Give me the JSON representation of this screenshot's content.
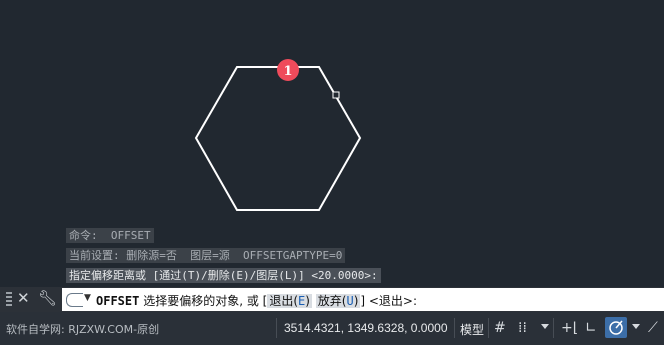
{
  "command_history": [
    "命令:  OFFSET",
    "当前设置: 删除源=否  图层=源  OFFSETGAPTYPE=0",
    "指定偏移距离或 [通过(T)/删除(E)/图层(L)] <20.0000>:"
  ],
  "command_line": {
    "command": "OFFSET",
    "prompt": "选择要偏移的对象, 或 [",
    "opt1_label": "退出(",
    "opt1_key": "E",
    "opt1_close": ")",
    "opt2_label": "放弃(",
    "opt2_key": "U",
    "opt2_close": ")",
    "suffix": "] <退出>:"
  },
  "marker_number": "1",
  "status_bar": {
    "watermark": "软件自学网: RJZXW.COM-原创",
    "coordinates": "3514.4321, 1349.6328, 0.0000",
    "model_label": "模型"
  },
  "colors": {
    "canvas_bg": "#212830",
    "hexagon_stroke": "#ffffff",
    "marker_fill": "#ef4b5b",
    "active_toggle": "#3c6ea8"
  },
  "icons": [
    "close-icon",
    "wrench-icon",
    "grid-icon",
    "snap-grid-icon",
    "ortho-icon",
    "polar-icon",
    "osnap-icon"
  ]
}
